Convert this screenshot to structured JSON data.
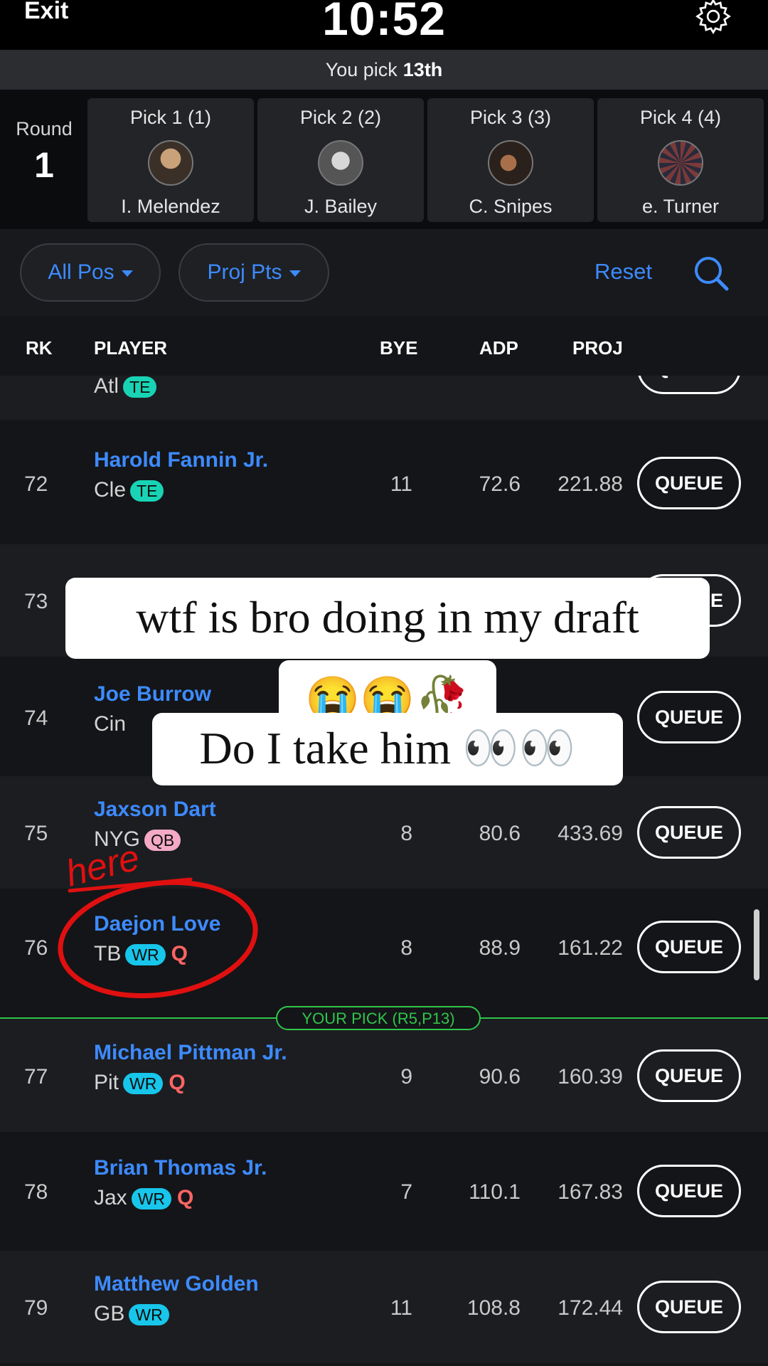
{
  "topbar": {
    "exit_label": "Exit",
    "timer": "10:52",
    "settings_icon": "gear-icon"
  },
  "pick_banner": {
    "text": "You pick",
    "pick": "13th"
  },
  "round": {
    "label": "Round",
    "number": "1"
  },
  "picks": [
    {
      "title": "Pick 1 (1)",
      "name": "I. Melendez"
    },
    {
      "title": "Pick 2 (2)",
      "name": "J. Bailey"
    },
    {
      "title": "Pick 3 (3)",
      "name": "C. Snipes"
    },
    {
      "title": "Pick 4 (4)",
      "name": "e. Turner"
    }
  ],
  "filters": {
    "position": "All Pos",
    "sort": "Proj Pts",
    "reset": "Reset",
    "search_icon": "search-icon"
  },
  "columns": {
    "rank": "RK",
    "player": "PLAYER",
    "bye": "BYE",
    "adp": "ADP",
    "proj": "PROJ"
  },
  "queue_label": "QUEUE",
  "partial_row": {
    "team": "Atl",
    "pos": "TE"
  },
  "players": [
    {
      "rank": "72",
      "name": "Harold Fannin Jr.",
      "team": "Cle",
      "pos": "TE",
      "q": "",
      "bye": "11",
      "adp": "72.6",
      "proj": "221.88"
    },
    {
      "rank": "73",
      "name": "",
      "team": "",
      "pos": "",
      "q": "",
      "bye": "",
      "adp": "",
      "proj": ""
    },
    {
      "rank": "74",
      "name": "Joe Burrow",
      "team": "Cin",
      "pos": "",
      "q": "",
      "bye": "",
      "adp": "",
      "proj": ""
    },
    {
      "rank": "75",
      "name": "Jaxson Dart",
      "team": "NYG",
      "pos": "QB",
      "q": "",
      "bye": "8",
      "adp": "80.6",
      "proj": "433.69"
    },
    {
      "rank": "76",
      "name": "Daejon Love",
      "team": "TB",
      "pos": "WR",
      "q": "Q",
      "bye": "8",
      "adp": "88.9",
      "proj": "161.22"
    },
    {
      "rank": "77",
      "name": "Michael Pittman Jr.",
      "team": "Pit",
      "pos": "WR",
      "q": "Q",
      "bye": "9",
      "adp": "90.6",
      "proj": "160.39"
    },
    {
      "rank": "78",
      "name": "Brian Thomas Jr.",
      "team": "Jax",
      "pos": "WR",
      "q": "Q",
      "bye": "7",
      "adp": "110.1",
      "proj": "167.83"
    },
    {
      "rank": "79",
      "name": "Matthew Golden",
      "team": "GB",
      "pos": "WR",
      "q": "",
      "bye": "11",
      "adp": "108.8",
      "proj": "172.44"
    }
  ],
  "your_pick": "YOUR PICK (R5,P13)",
  "captions": {
    "line1": "wtf is bro doing in my draft",
    "line2": "😭😭🥀",
    "line3": "Do I take him 👀👀"
  },
  "annotation_text": "here",
  "colors": {
    "accent": "#3d8bff",
    "your_pick": "#2fc64b",
    "annotation": "#e01010",
    "te": "#19d4b4",
    "wr": "#17c6ea",
    "qb": "#f4a9c4"
  }
}
